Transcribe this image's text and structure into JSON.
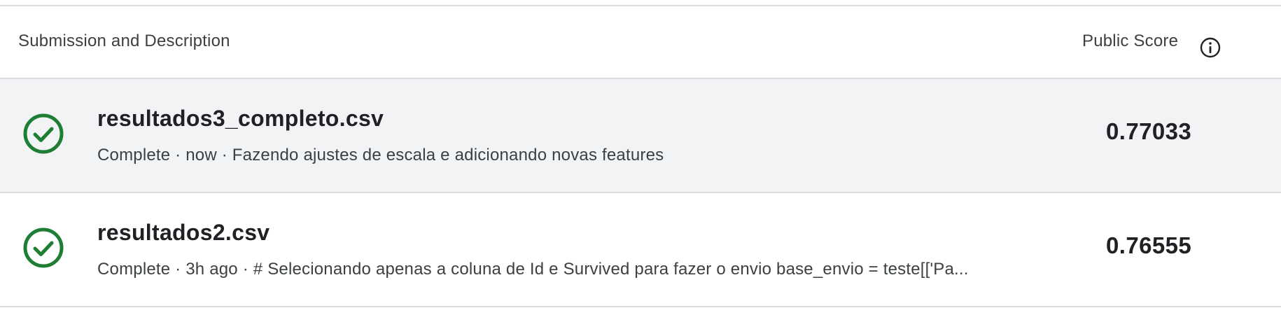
{
  "header": {
    "left_label": "Submission and Description",
    "right_label": "Public Score",
    "info_icon": "info-icon"
  },
  "submissions": [
    {
      "file_name": "resultados3_completo.csv",
      "description_line": "Complete · now · Fazendo ajustes de escala e adicionando novas features",
      "score": "0.77033",
      "status_icon": "check-circle-icon",
      "highlighted": true
    },
    {
      "file_name": "resultados2.csv",
      "description_line": "Complete · 3h ago · # Selecionando apenas a coluna de Id e Survived para fazer o envio base_envio = teste[['Pa...",
      "score": "0.76555",
      "status_icon": "check-circle-icon",
      "highlighted": false
    }
  ],
  "colors": {
    "success_green": "#1e7e34",
    "row_highlight": "#f1f3f4",
    "divider": "#dadce0"
  }
}
